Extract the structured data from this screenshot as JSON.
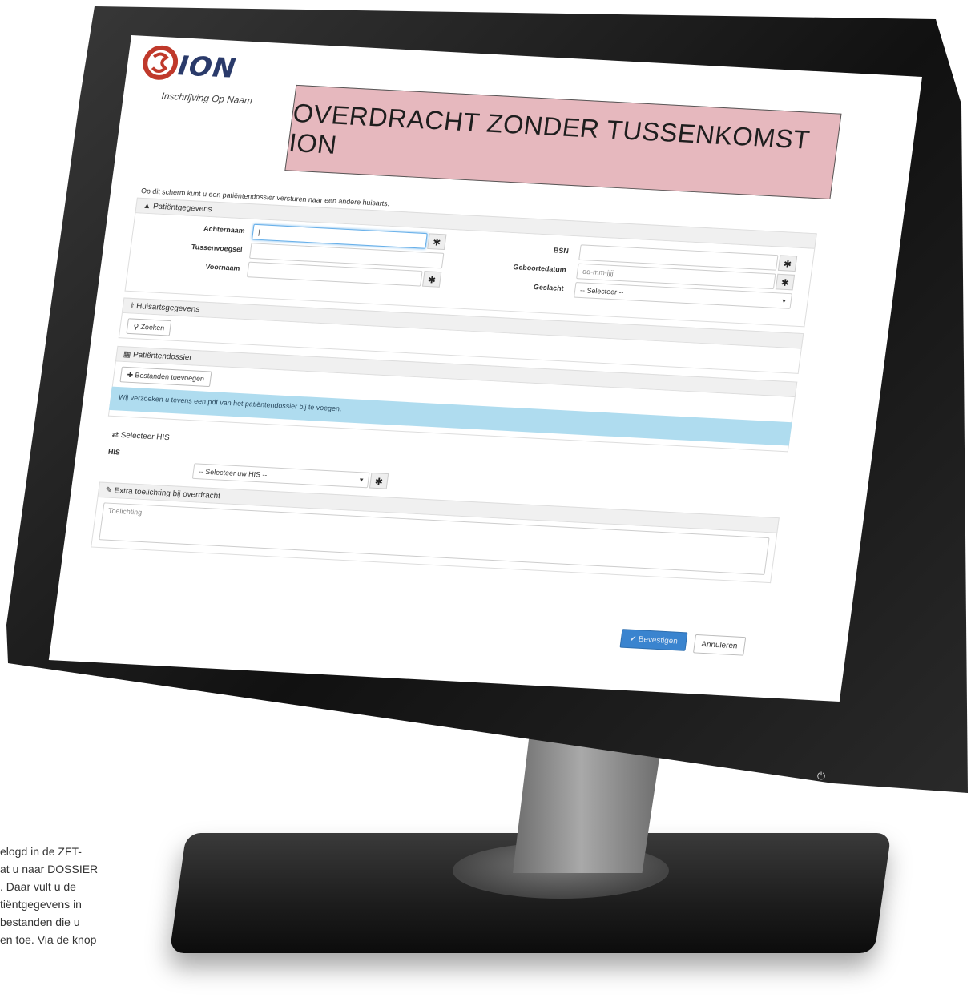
{
  "header": {
    "logo_text": "ION",
    "logo_subtitle": "Inschrijving Op Naam",
    "banner_title": "OVERDRACHT ZONDER TUSSENKOMST ION"
  },
  "intro_text": "Op dit scherm kunt u een patiëntendossier versturen naar een andere huisarts.",
  "patient": {
    "title": "Patiëntgegevens",
    "achternaam_label": "Achternaam",
    "achternaam_value": "|",
    "tussenvoegsel_label": "Tussenvoegsel",
    "voornaam_label": "Voornaam",
    "bsn_label": "BSN",
    "geboortedatum_label": "Geboortedatum",
    "geboortedatum_placeholder": "dd-mm-jjjj",
    "geslacht_label": "Geslacht",
    "geslacht_selected": "-- Selecteer --",
    "required_mark": "✱"
  },
  "huisarts": {
    "title": "Huisartsgegevens",
    "search_button": "Zoeken"
  },
  "dossier": {
    "title": "Patiëntendossier",
    "add_files_button": "Bestanden toevoegen",
    "info_text": "Wij verzoeken u tevens een pdf van het patiëntendossier bij te voegen."
  },
  "his": {
    "title": "Selecteer HIS",
    "label": "HIS",
    "selected": "-- Selecteer uw HIS --"
  },
  "extra": {
    "title": "Extra toelichting bij overdracht",
    "placeholder": "Toelichting"
  },
  "actions": {
    "confirm_button": "Bevestigen",
    "cancel_button": "Annuleren"
  },
  "caption_lines": [
    "elogd in de ZFT-",
    "at u naar DOSSIER",
    ". Daar vult u de",
    "tiëntgegevens in",
    "bestanden die u",
    "en toe. Via de knop"
  ],
  "colors": {
    "banner_bg": "#e6b8be",
    "info_bg": "#afdcef",
    "primary_button": "#3a84cf",
    "logo_red": "#c0392b",
    "logo_blue": "#2a3a6a"
  }
}
